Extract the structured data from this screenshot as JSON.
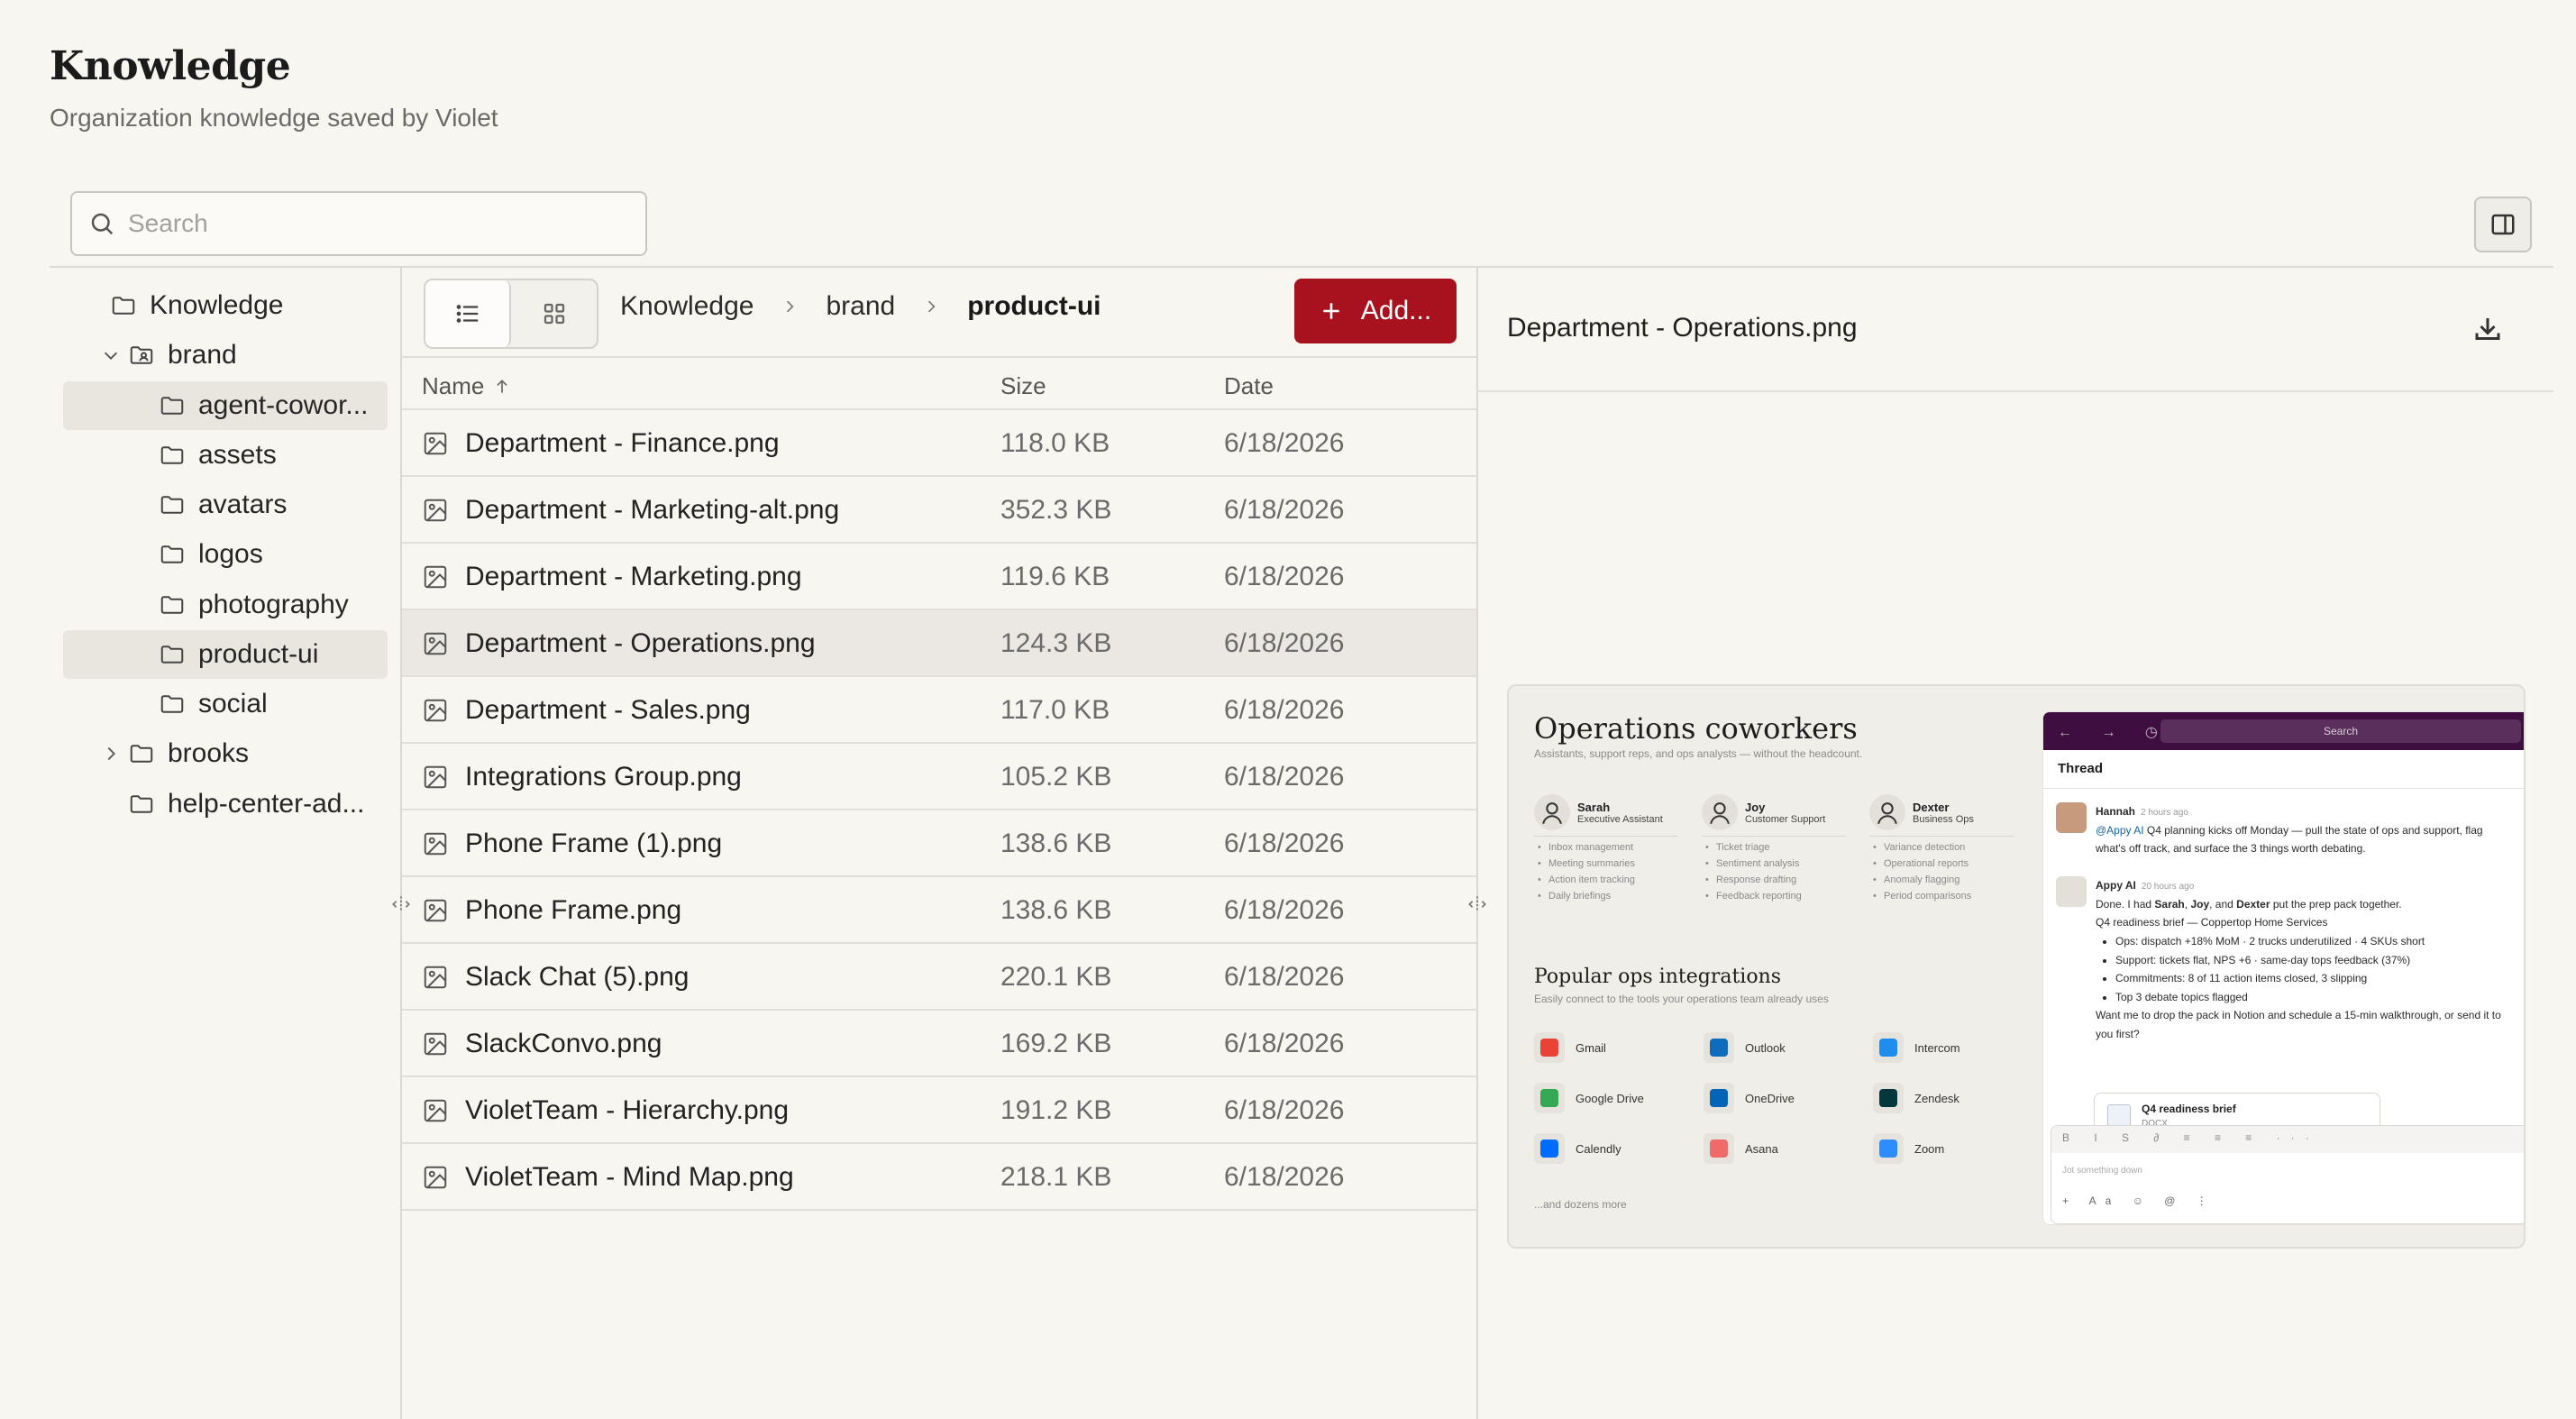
{
  "header": {
    "title": "Knowledge",
    "subtitle": "Organization knowledge saved by Violet"
  },
  "search": {
    "placeholder": "Search",
    "value": ""
  },
  "tree": [
    {
      "label": "Knowledge",
      "level": 0,
      "expander": "none",
      "selected": false
    },
    {
      "label": "brand",
      "level": 0,
      "expander": "expanded",
      "selected": false
    },
    {
      "label": "agent-cowor...",
      "level": 1,
      "expander": "none",
      "selected": true
    },
    {
      "label": "assets",
      "level": 1,
      "expander": "none",
      "selected": false
    },
    {
      "label": "avatars",
      "level": 1,
      "expander": "none",
      "selected": false
    },
    {
      "label": "logos",
      "level": 1,
      "expander": "none",
      "selected": false
    },
    {
      "label": "photography",
      "level": 1,
      "expander": "none",
      "selected": false
    },
    {
      "label": "product-ui",
      "level": 1,
      "expander": "none",
      "selected": true
    },
    {
      "label": "social",
      "level": 1,
      "expander": "none",
      "selected": false
    },
    {
      "label": "brooks",
      "level": 0,
      "expander": "collapsed",
      "selected": false
    },
    {
      "label": "help-center-ad...",
      "level": 0,
      "expander": "none",
      "selected": false
    }
  ],
  "toolbar": {
    "breadcrumb": [
      "Knowledge",
      "brand",
      "product-ui"
    ],
    "add_label": "Add...",
    "view_mode": "list"
  },
  "table": {
    "columns": {
      "name": "Name",
      "size": "Size",
      "date": "Date"
    },
    "sort": "name-ascending",
    "rows": [
      {
        "name": "Department - Finance.png",
        "size": "118.0 KB",
        "date": "6/18/2026"
      },
      {
        "name": "Department - Marketing-alt.png",
        "size": "352.3 KB",
        "date": "6/18/2026"
      },
      {
        "name": "Department - Marketing.png",
        "size": "119.6 KB",
        "date": "6/18/2026"
      },
      {
        "name": "Department - Operations.png",
        "size": "124.3 KB",
        "date": "6/18/2026"
      },
      {
        "name": "Department - Sales.png",
        "size": "117.0 KB",
        "date": "6/18/2026"
      },
      {
        "name": "Integrations Group.png",
        "size": "105.2 KB",
        "date": "6/18/2026"
      },
      {
        "name": "Phone Frame (1).png",
        "size": "138.6 KB",
        "date": "6/18/2026"
      },
      {
        "name": "Phone Frame.png",
        "size": "138.6 KB",
        "date": "6/18/2026"
      },
      {
        "name": "Slack Chat (5).png",
        "size": "220.1 KB",
        "date": "6/18/2026"
      },
      {
        "name": "SlackConvo.png",
        "size": "169.2 KB",
        "date": "6/18/2026"
      },
      {
        "name": "VioletTeam - Hierarchy.png",
        "size": "191.2 KB",
        "date": "6/18/2026"
      },
      {
        "name": "VioletTeam - Mind Map.png",
        "size": "218.1 KB",
        "date": "6/18/2026"
      }
    ],
    "selected_row": "Department - Operations.png"
  },
  "preview": {
    "title": "Department - Operations.png",
    "image": {
      "heading": "Operations coworkers",
      "subheading": "Assistants, support reps, and ops analysts — without the headcount.",
      "coworkers": [
        {
          "name": "Sarah",
          "role": "Executive Assistant",
          "skills": [
            "Inbox management",
            "Meeting summaries",
            "Action item tracking",
            "Daily briefings"
          ]
        },
        {
          "name": "Joy",
          "role": "Customer Support",
          "skills": [
            "Ticket triage",
            "Sentiment analysis",
            "Response drafting",
            "Feedback reporting"
          ]
        },
        {
          "name": "Dexter",
          "role": "Business Ops",
          "skills": [
            "Variance detection",
            "Operational reports",
            "Anomaly flagging",
            "Period comparisons"
          ]
        }
      ],
      "integrations_heading": "Popular ops integrations",
      "integrations_sub": "Easily connect to the tools your operations team already uses",
      "integrations": [
        {
          "name": "Gmail",
          "color": "#ea4335"
        },
        {
          "name": "Outlook",
          "color": "#0f6cbd"
        },
        {
          "name": "Intercom",
          "color": "#1f8ded"
        },
        {
          "name": "Google Drive",
          "color": "#34a853"
        },
        {
          "name": "OneDrive",
          "color": "#0364b8"
        },
        {
          "name": "Zendesk",
          "color": "#03363d"
        },
        {
          "name": "Calendly",
          "color": "#006bff"
        },
        {
          "name": "Asana",
          "color": "#f06a6a"
        },
        {
          "name": "Zoom",
          "color": "#2d8cff"
        }
      ],
      "more_text": "...and dozens more",
      "slack": {
        "nav": "← → ◷",
        "search": "Search",
        "thread_label": "Thread",
        "msg1": {
          "who": "Hannah",
          "time": "2 hours ago",
          "mention": "@Appy AI",
          "text": "Q4 planning kicks off Monday — pull the state of ops and support, flag what's off track, and surface the 3 things worth debating."
        },
        "msg2": {
          "who": "Appy AI",
          "time": "20 hours ago",
          "text_a": "Done. I had",
          "n1": "Sarah",
          "text_b": ",",
          "n2": "Joy",
          "text_c": ", and",
          "n3": "Dexter",
          "text_d": "put the prep pack together.",
          "line2": "Q4 readiness brief — Coppertop Home Services",
          "bullets": [
            "Ops: dispatch +18% MoM · 2 trucks underutilized · 4 SKUs short",
            "Support: tickets flat, NPS +6 · same-day tops feedback (37%)",
            "Commitments: 8 of 11 action items closed, 3 slipping",
            "Top 3 debate topics flagged"
          ],
          "closing": "Want me to drop the pack in Notion and schedule a 15-min walkthrough, or send it to you first?"
        },
        "doc": {
          "title": "Q4 readiness brief",
          "type": "DOCX"
        },
        "composer_tools": "B I S ∂ ≡ ≡ ≡ ···",
        "composer_placeholder": "Jot something down",
        "composer_bottom": "+ Aa ☺ @ ⋮"
      }
    }
  },
  "colors": {
    "accent": "#a8121f",
    "background": "#f8f6f1",
    "selected_row": "#ebe8e3"
  }
}
